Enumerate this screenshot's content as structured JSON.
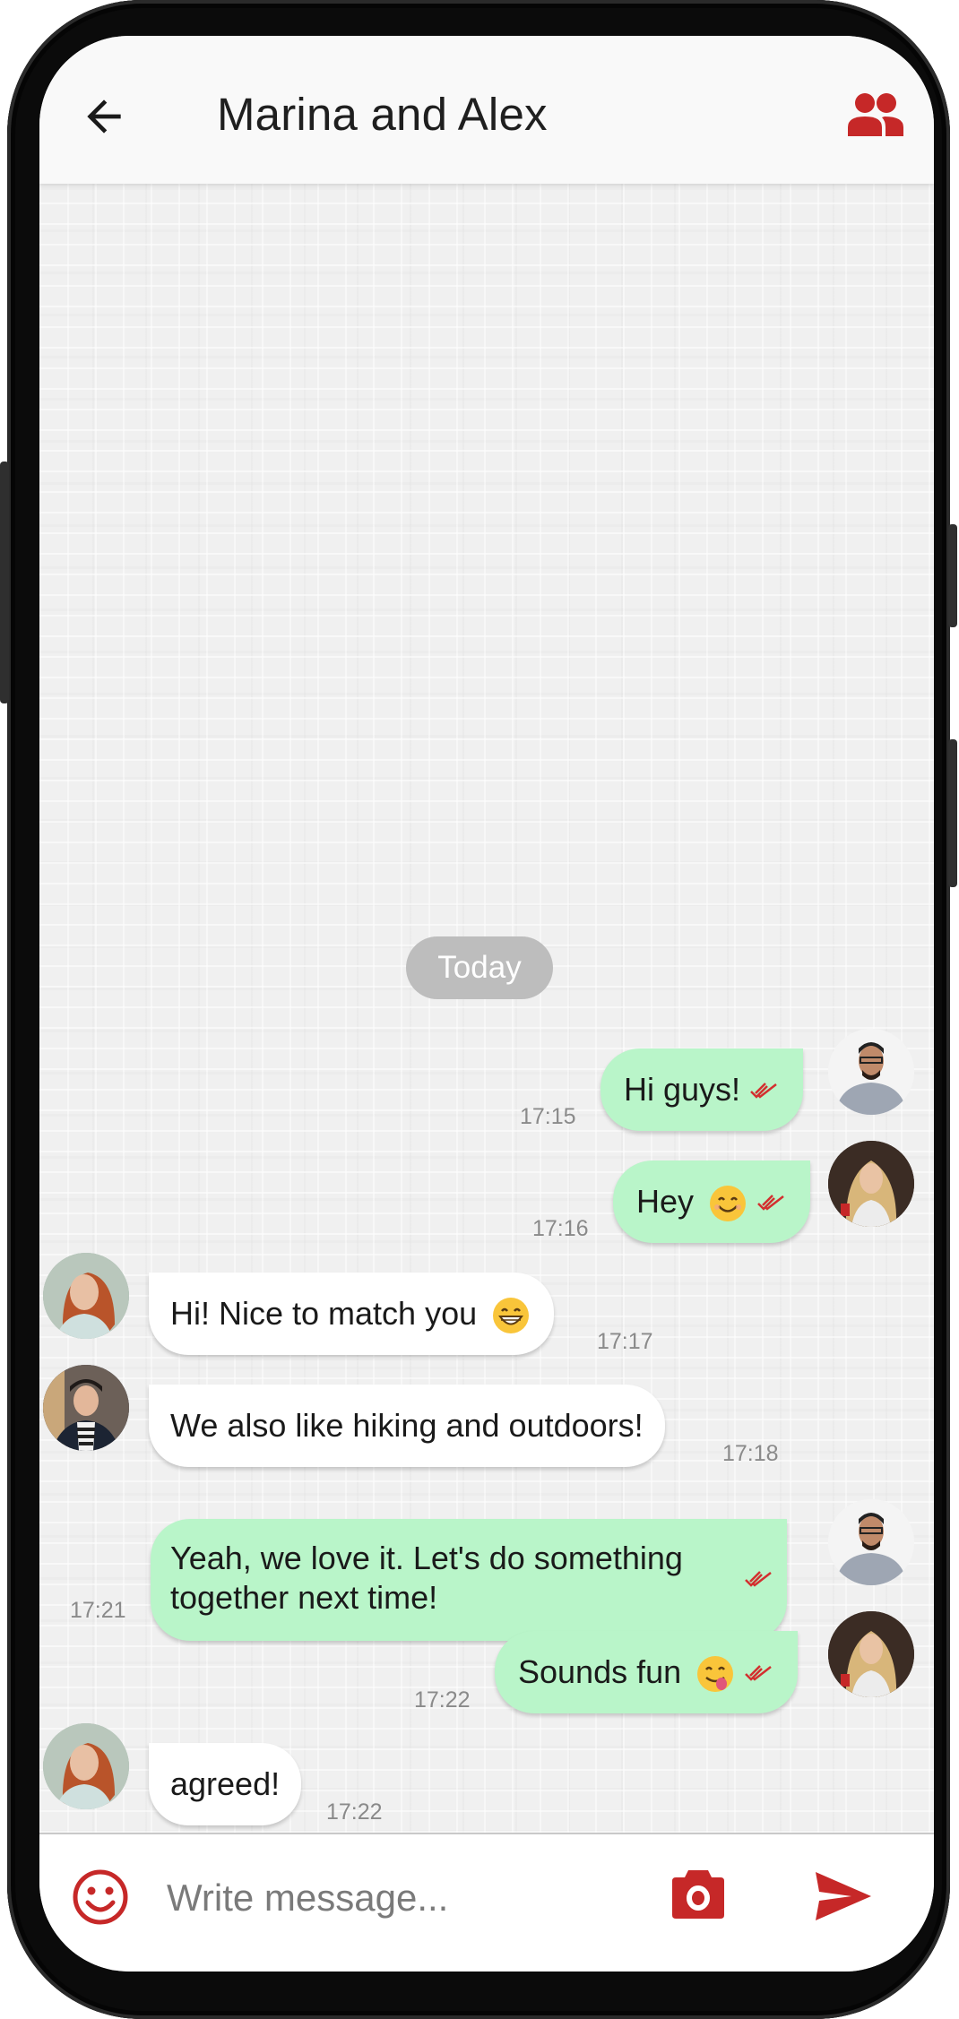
{
  "header": {
    "title": "Marina and Alex",
    "back_icon": "arrow-left-icon",
    "group_icon": "group-icon"
  },
  "colors": {
    "accent": "#c62828",
    "outgoing_bubble": "#b9f5c9",
    "incoming_bubble": "#ffffff",
    "day_pill": "#bdbdbd"
  },
  "chat": {
    "day_separator": "Today",
    "messages": [
      {
        "direction": "outgoing",
        "sender": "man-with-glasses",
        "text": "Hi guys!",
        "emoji": "",
        "time": "17:15",
        "status": "read"
      },
      {
        "direction": "outgoing",
        "sender": "blonde-woman",
        "text": "Hey",
        "emoji": "smiling-face",
        "time": "17:16",
        "status": "read"
      },
      {
        "direction": "incoming",
        "sender": "Marina",
        "text": "Hi! Nice to match you",
        "emoji": "grinning-face",
        "time": "17:17"
      },
      {
        "direction": "incoming",
        "sender": "Alex",
        "text": "We also like hiking and outdoors!",
        "emoji": "",
        "time": "17:18"
      },
      {
        "direction": "outgoing",
        "sender": "man-with-glasses",
        "text_line1": "Yeah, we love it. Let's do something",
        "text_line2": "together next time!",
        "emoji": "",
        "time": "17:21",
        "status": "read"
      },
      {
        "direction": "outgoing",
        "sender": "blonde-woman",
        "text": "Sounds fun",
        "emoji": "face-savoring-food",
        "time": "17:22",
        "status": "read"
      },
      {
        "direction": "incoming",
        "sender": "Marina",
        "text": "agreed!",
        "emoji": "",
        "time": "17:22"
      }
    ]
  },
  "composer": {
    "placeholder": "Write message...",
    "value": "",
    "emoji_icon": "smiley-icon",
    "camera_icon": "camera-icon",
    "send_icon": "send-icon"
  }
}
